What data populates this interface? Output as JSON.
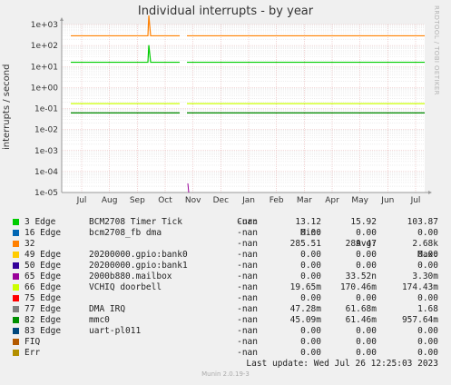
{
  "title": "Individual interrupts - by year",
  "side_text": "RRDTOOL / TOBI OETIKER",
  "footer": "Munin 2.0.19-3",
  "last_update": "Last update:  Wed Jul 26 12:25:03 2023",
  "legend_headers": {
    "cur": "Cur:",
    "min": "Min:",
    "avg": "Avg:",
    "max": "Max:"
  },
  "chart_data": {
    "type": "line",
    "ylabel": "interrupts / second",
    "yscale": "log",
    "ylim": [
      1e-05,
      1000.0
    ],
    "y_ticks": [
      "1e-05",
      "1e-04",
      "1e-03",
      "1e-02",
      "1e-01",
      "1e+00",
      "1e+01",
      "1e+02",
      "1e+03"
    ],
    "x_ticks": [
      "Jul",
      "Aug",
      "Sep",
      "Oct",
      "Nov",
      "Dec",
      "Jan",
      "Feb",
      "Mar",
      "Apr",
      "May",
      "Jun",
      "Jul"
    ],
    "grid": true,
    "series": [
      {
        "name": "3 Edge",
        "desc": "BCM2708 Timer Tick",
        "color": "#00cc00",
        "cur": "-nan",
        "min": "13.12",
        "avg": "15.92",
        "max": "103.87",
        "level": 15.92,
        "spike": 103.87
      },
      {
        "name": "16 Edge",
        "desc": "bcm2708_fb dma",
        "color": "#0066b3",
        "cur": "-nan",
        "min": "0.00",
        "avg": "0.00",
        "max": "0.00",
        "level": null,
        "spike": null
      },
      {
        "name": "32",
        "desc": "",
        "color": "#ff8000",
        "cur": "-nan",
        "min": "285.51",
        "avg": "289.47",
        "max": "2.68k",
        "level": 289.47,
        "spike": 2680
      },
      {
        "name": "49 Edge",
        "desc": "20200000.gpio:bank0",
        "color": "#ffcc00",
        "cur": "-nan",
        "min": "0.00",
        "avg": "0.00",
        "max": "0.00",
        "level": null,
        "spike": null
      },
      {
        "name": "50 Edge",
        "desc": "20200000.gpio:bank1",
        "color": "#330099",
        "cur": "-nan",
        "min": "0.00",
        "avg": "0.00",
        "max": "0.00",
        "level": null,
        "spike": null
      },
      {
        "name": "65 Edge",
        "desc": "2000b880.mailbox",
        "color": "#990099",
        "cur": "-nan",
        "min": "0.00",
        "avg": "33.52n",
        "max": "3.30m",
        "level": null,
        "spike": null
      },
      {
        "name": "66 Edge",
        "desc": "VCHIQ doorbell",
        "color": "#ccff00",
        "cur": "-nan",
        "min": "19.65m",
        "avg": "170.46m",
        "max": "174.43m",
        "level": 0.17046,
        "spike": null
      },
      {
        "name": "75 Edge",
        "desc": "",
        "color": "#ff0000",
        "cur": "-nan",
        "min": "0.00",
        "avg": "0.00",
        "max": "0.00",
        "level": null,
        "spike": null
      },
      {
        "name": "77 Edge",
        "desc": "DMA IRQ",
        "color": "#808080",
        "cur": "-nan",
        "min": "47.28m",
        "avg": "61.68m",
        "max": "1.68",
        "level": 0.06168,
        "spike": null
      },
      {
        "name": "82 Edge",
        "desc": "mmc0",
        "color": "#008f00",
        "cur": "-nan",
        "min": "45.09m",
        "avg": "61.46m",
        "max": "957.64m",
        "level": 0.06146,
        "spike": null
      },
      {
        "name": "83 Edge",
        "desc": "uart-pl011",
        "color": "#00487d",
        "cur": "-nan",
        "min": "0.00",
        "avg": "0.00",
        "max": "0.00",
        "level": null,
        "spike": null
      },
      {
        "name": "FIQ",
        "desc": "",
        "color": "#b35a00",
        "cur": "-nan",
        "min": "0.00",
        "avg": "0.00",
        "max": "0.00",
        "level": null,
        "spike": null
      },
      {
        "name": "Err",
        "desc": "",
        "color": "#b38f00",
        "cur": "-nan",
        "min": "0.00",
        "avg": "0.00",
        "max": "0.00",
        "level": null,
        "spike": null
      }
    ]
  }
}
